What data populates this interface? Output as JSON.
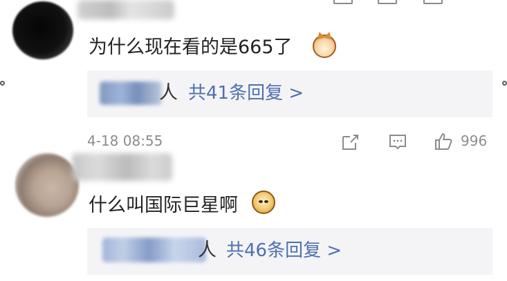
{
  "comments": [
    {
      "text": "为什么现在看的是665了",
      "reply_suffix": "人",
      "reply_link": "共41条回复 >"
    },
    {
      "text": "什么叫国际巨星啊",
      "reply_suffix": "人",
      "reply_link": "共46条回复 >"
    }
  ],
  "meta": {
    "timestamp": "4-18 08:55",
    "likes": "996"
  },
  "icons": {
    "share": "share-icon",
    "comment": "comment-icon",
    "like": "thumb-up-icon",
    "cat_emoji": "cat-emoji-icon",
    "doge_emoji": "doge-emoji-icon"
  },
  "colors": {
    "reply_link": "#4f6fae",
    "reply_background": "#f4f4f6",
    "meta_text": "#8c8c8c"
  }
}
